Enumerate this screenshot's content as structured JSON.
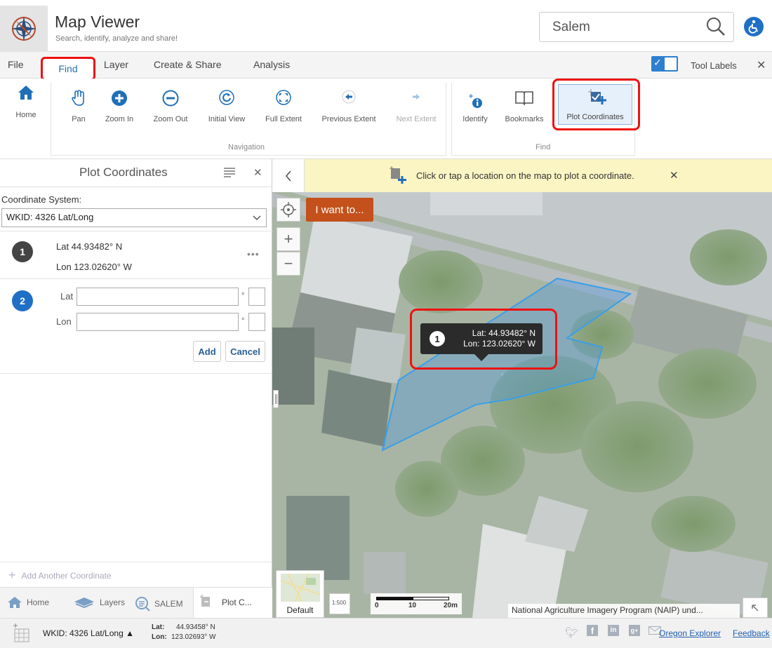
{
  "app": {
    "title": "Map Viewer",
    "subtitle": "Search, identify, analyze and share!"
  },
  "search": {
    "value": "Salem"
  },
  "menu": {
    "tabs": [
      "File",
      "Find",
      "Layer",
      "Create & Share",
      "Analysis"
    ],
    "active_tab": "Find",
    "tool_labels": "Tool Labels",
    "tool_labels_on": true
  },
  "toolbar": {
    "home": "Home",
    "pan": "Pan",
    "zoom_in": "Zoom In",
    "zoom_out": "Zoom Out",
    "initial_view": "Initial View",
    "full_extent": "Full Extent",
    "previous_extent": "Previous Extent",
    "next_extent": "Next Extent",
    "identify": "Identify",
    "bookmarks": "Bookmarks",
    "plot_coordinates": "Plot Coordinates",
    "group_navigation": "Navigation",
    "group_find": "Find"
  },
  "panel": {
    "title": "Plot Coordinates",
    "coord_system_label": "Coordinate System:",
    "coord_system_value": "WKID: 4326 Lat/Long",
    "coord1": {
      "num": "1",
      "lat": "Lat  44.93482° N",
      "lon": "Lon  123.02620° W"
    },
    "coord2": {
      "num": "2",
      "lat_label": "Lat",
      "lon_label": "Lon",
      "deg": "°"
    },
    "add_label": "Add",
    "cancel_label": "Cancel",
    "add_another": "Add Another Coordinate"
  },
  "bottom_tabs": {
    "home": "Home",
    "layers": "Layers",
    "salem": "SALEM",
    "plot": "Plot C..."
  },
  "status": {
    "wkid": "WKID: 4326 Lat/Long ▲",
    "lat_label": "Lat:",
    "lat_value": "44.93458° N",
    "lon_label": "Lon:",
    "lon_value": "123.02693° W",
    "oregon_explorer": "Oregon Explorer",
    "feedback": "Feedback"
  },
  "map": {
    "notice": "Click or tap a location on the map to plot a coordinate.",
    "i_want_to": "I want to...",
    "popup_num": "1",
    "popup_lat": "Lat: 44.93482° N",
    "popup_lon": "Lon: 123.02620° W",
    "basemap_label": "Default",
    "scale_labels": [
      "0",
      "10",
      "20m"
    ],
    "scale_ratio": "1:500",
    "attribution": "National Agriculture Imagery Program (NAIP) und..."
  },
  "colors": {
    "accent": "#2474b8",
    "highlight_red": "#e11111",
    "notice_bg": "#fbf5c4",
    "iwant_bg": "#c4501b"
  }
}
